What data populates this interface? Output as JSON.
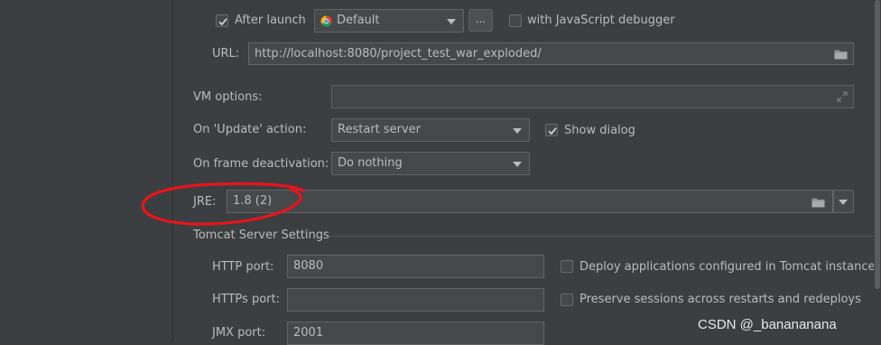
{
  "after_launch": {
    "label": "After launch",
    "checked": true,
    "browser": "Default",
    "browser_icon": "chrome-icon",
    "more_button": "...",
    "js_debugger_label": "with JavaScript debugger",
    "js_debugger_checked": false
  },
  "url": {
    "label": "URL:",
    "value": "http://localhost:8080/project_test_war_exploded/"
  },
  "vm_options": {
    "label": "VM options:",
    "value": ""
  },
  "update_action": {
    "label": "On 'Update' action:",
    "value": "Restart server",
    "show_dialog_label": "Show dialog",
    "show_dialog_checked": true
  },
  "frame_deactivation": {
    "label": "On frame deactivation:",
    "value": "Do nothing"
  },
  "jre": {
    "label": "JRE:",
    "value": "1.8 (2)"
  },
  "tomcat": {
    "section_title": "Tomcat Server Settings",
    "http_port_label": "HTTP port:",
    "http_port": "8080",
    "https_port_label": "HTTPs port:",
    "https_port": "",
    "jmx_port_label": "JMX port:",
    "jmx_port": "2001",
    "deploy_label": "Deploy applications configured in Tomcat instance",
    "deploy_checked": false,
    "preserve_label": "Preserve sessions across restarts and redeploys",
    "preserve_checked": false
  },
  "annotation_color": "#e8141c",
  "watermark": "CSDN @_banananana"
}
